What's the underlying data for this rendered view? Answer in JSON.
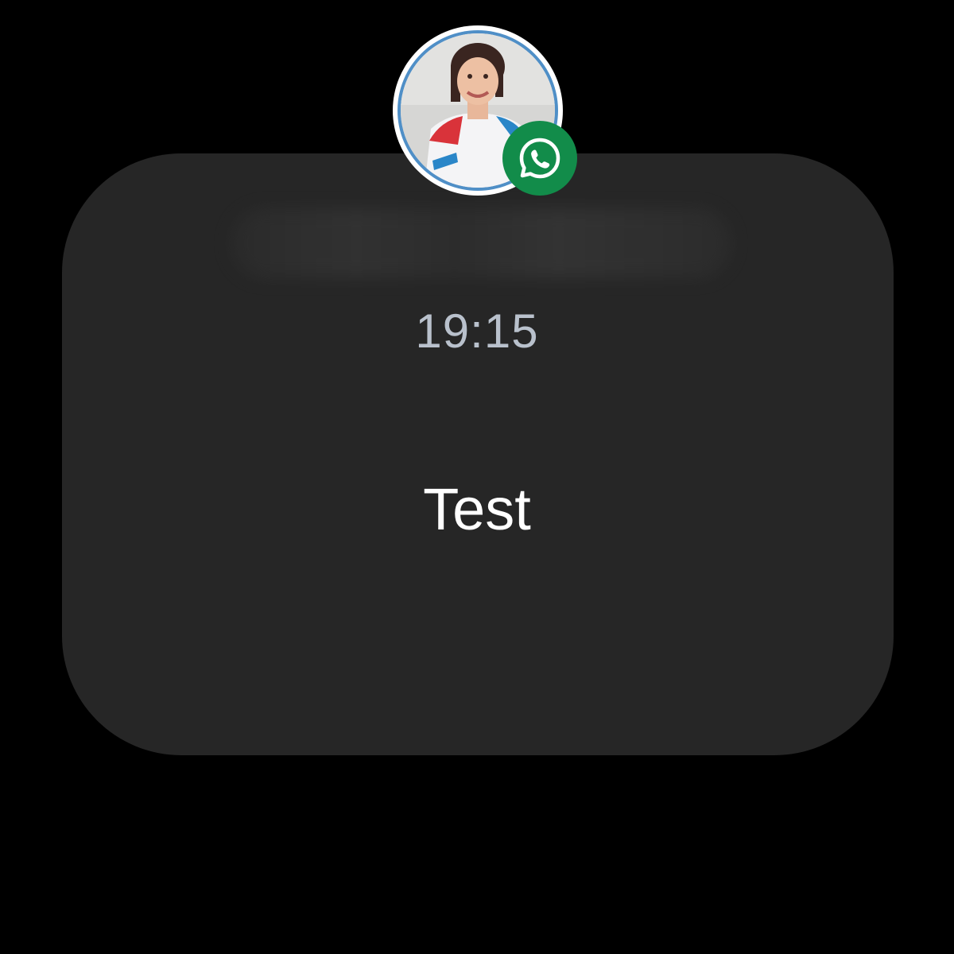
{
  "notification": {
    "time": "19:15",
    "message": "Test",
    "app_badge_icon": "whatsapp-icon",
    "avatar": "contact-avatar-photo"
  },
  "colors": {
    "background": "#000000",
    "card": "#262626",
    "time_text": "#b9c1cc",
    "message_text": "#ffffff",
    "badge": "#128c4a"
  }
}
